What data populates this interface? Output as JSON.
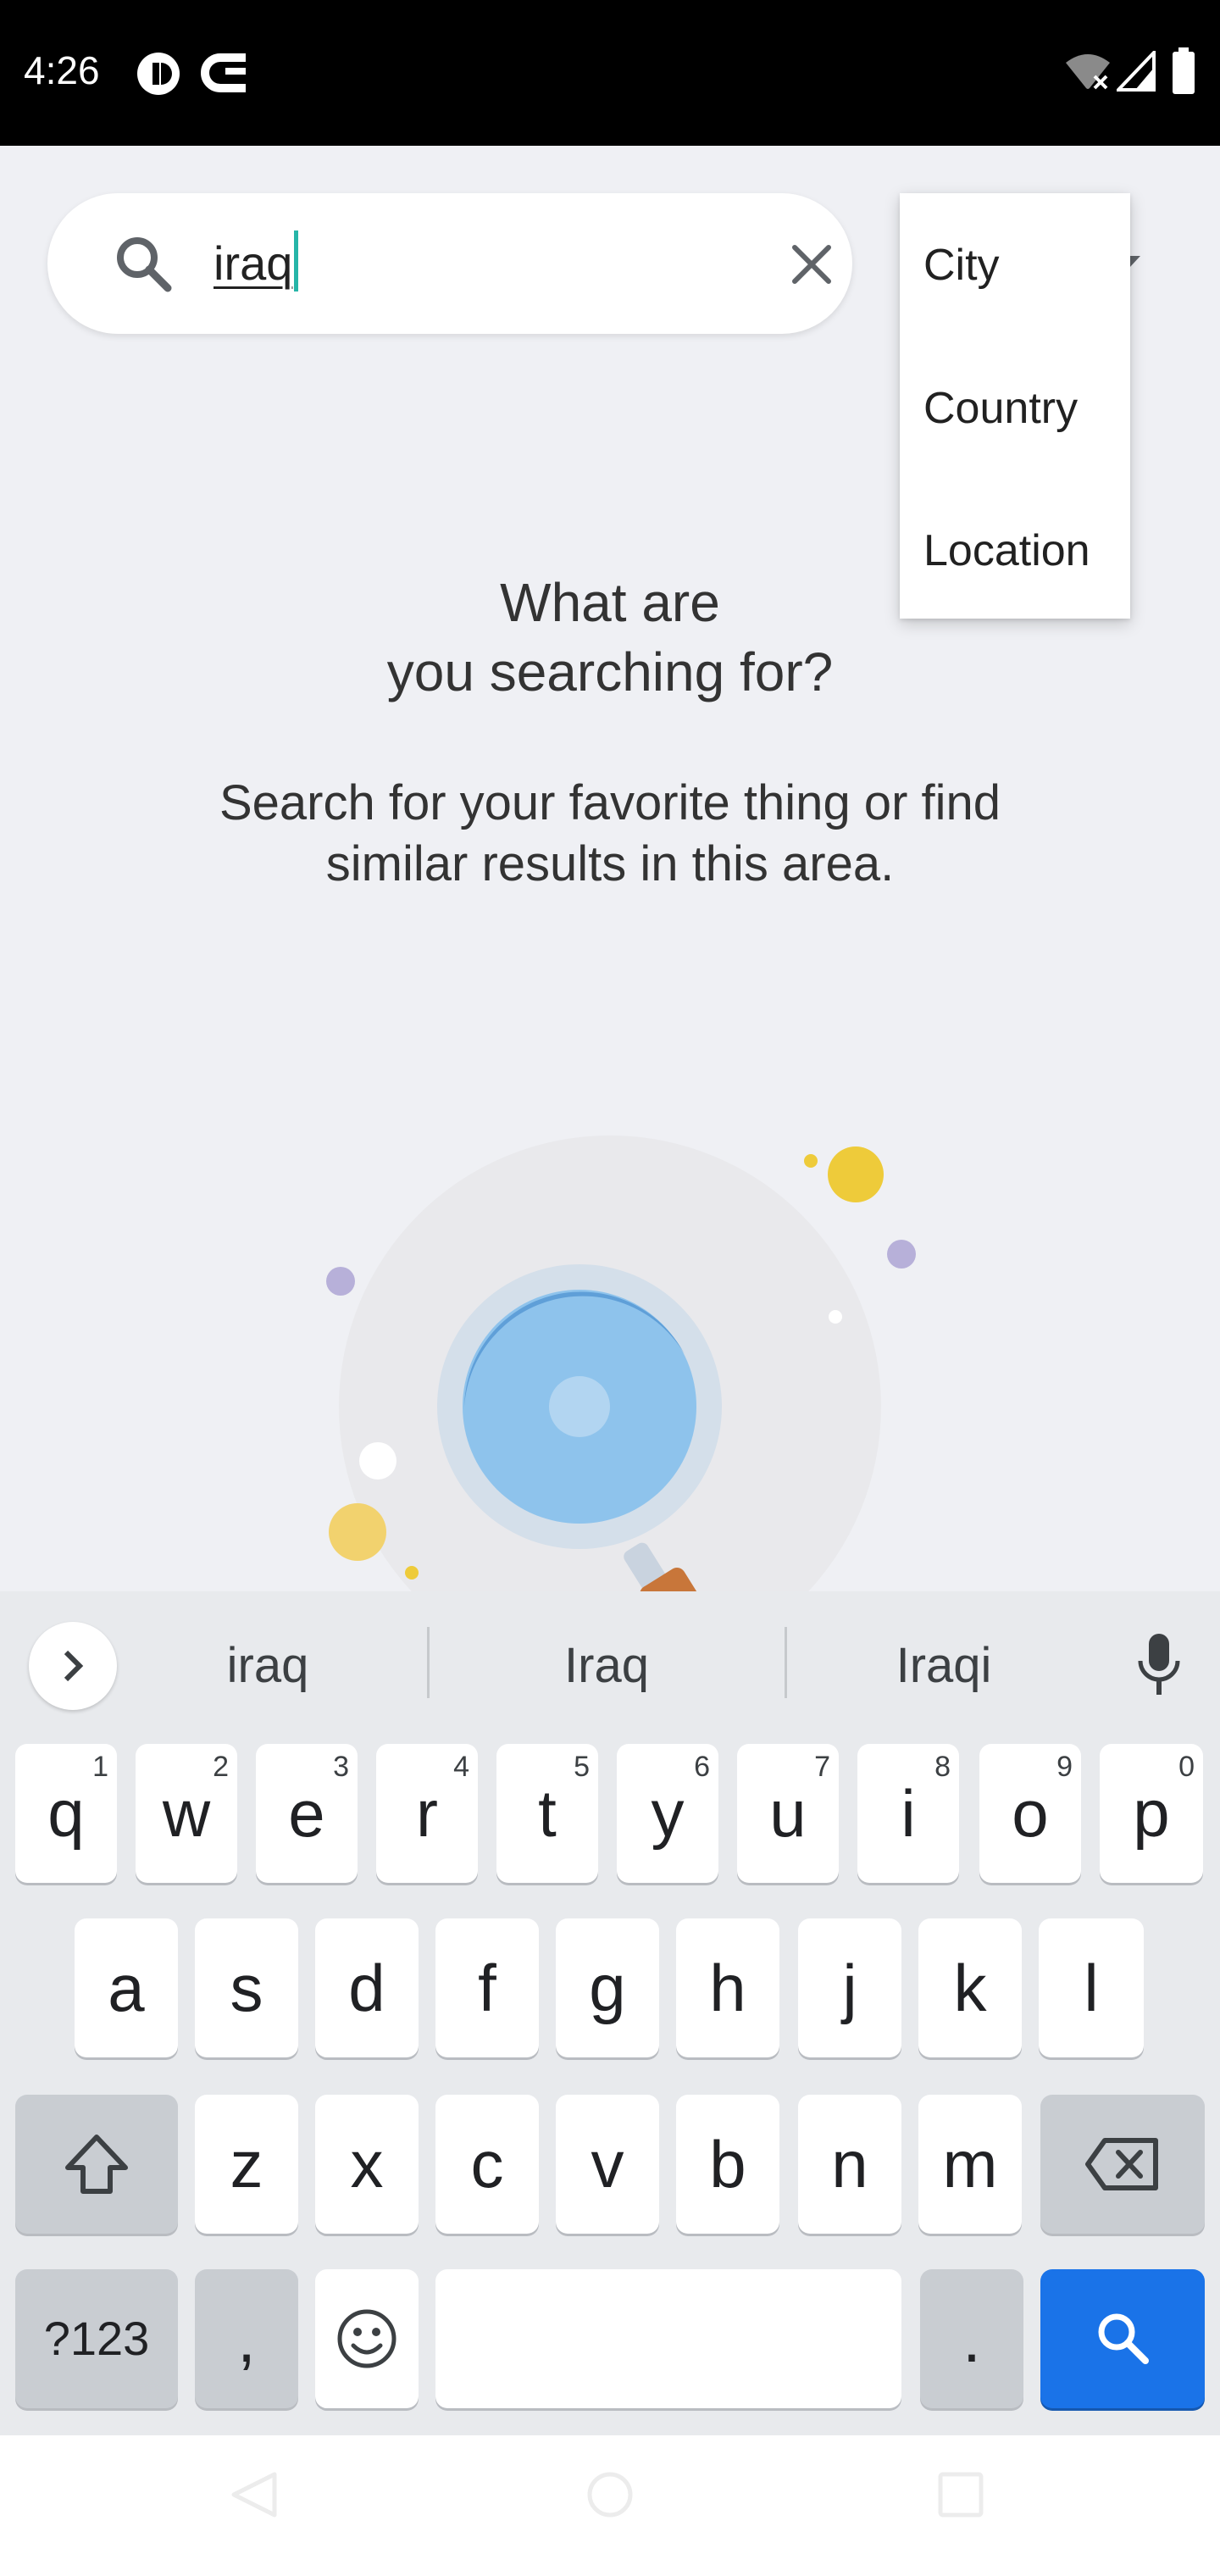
{
  "status_bar": {
    "time": "4:26",
    "left_icons": [
      "privacy-icon",
      "cast-c-icon"
    ],
    "right_icons": [
      "wifi-off-icon",
      "signal-icon",
      "battery-icon"
    ]
  },
  "search": {
    "value": "iraq",
    "placeholder": "",
    "clear_icon": "close-icon"
  },
  "filter_menu": {
    "items": [
      {
        "label": "City"
      },
      {
        "label": "Country"
      },
      {
        "label": "Location"
      }
    ]
  },
  "empty_state": {
    "title_line1": "What are",
    "title_line2": "you searching for?",
    "subtitle_line1": "Search for your favorite thing or find",
    "subtitle_line2": "similar results in this area.",
    "illustration": "magnifier-illustration"
  },
  "keyboard": {
    "suggestions": [
      "iraq",
      "Iraq",
      "Iraqi"
    ],
    "row1": [
      {
        "key": "q",
        "hint": "1"
      },
      {
        "key": "w",
        "hint": "2"
      },
      {
        "key": "e",
        "hint": "3"
      },
      {
        "key": "r",
        "hint": "4"
      },
      {
        "key": "t",
        "hint": "5"
      },
      {
        "key": "y",
        "hint": "6"
      },
      {
        "key": "u",
        "hint": "7"
      },
      {
        "key": "i",
        "hint": "8"
      },
      {
        "key": "o",
        "hint": "9"
      },
      {
        "key": "p",
        "hint": "0"
      }
    ],
    "row2": [
      "a",
      "s",
      "d",
      "f",
      "g",
      "h",
      "j",
      "k",
      "l"
    ],
    "row3": [
      "z",
      "x",
      "c",
      "v",
      "b",
      "n",
      "m"
    ],
    "symbols_key": "?123",
    "comma_key": ",",
    "period_key": ".",
    "colors": {
      "action": "#1a73e8",
      "background": "#e8eaed"
    }
  }
}
